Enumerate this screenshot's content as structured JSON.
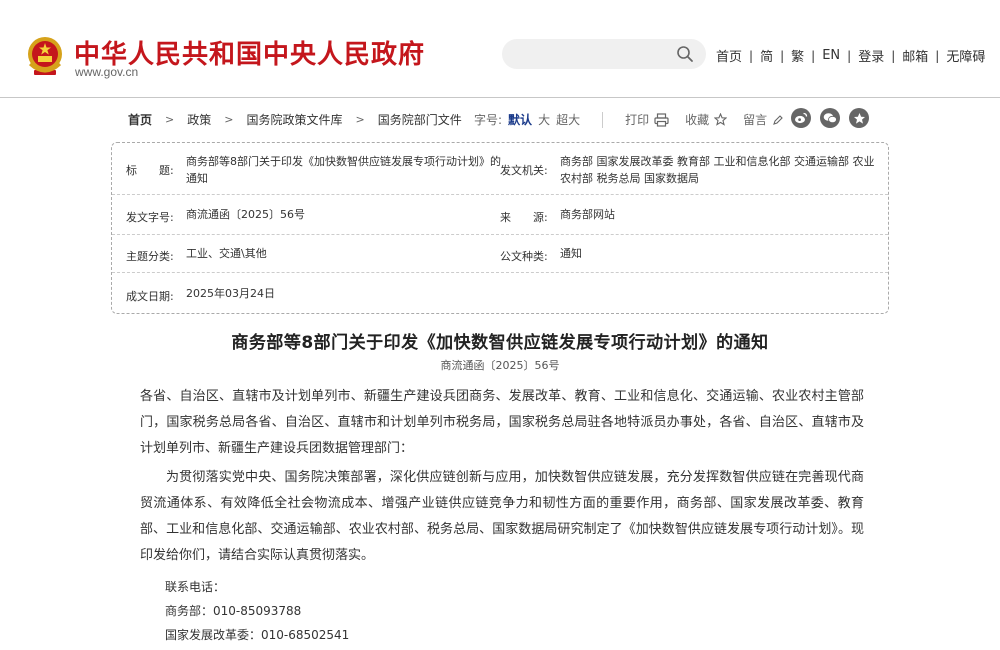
{
  "header": {
    "site_title": "中华人民共和国中央人民政府",
    "site_url": "www.gov.cn",
    "search_placeholder": "",
    "links": [
      "首页",
      "简",
      "繁",
      "EN",
      "登录",
      "邮箱",
      "无障碍"
    ]
  },
  "breadcrumb": [
    "首页",
    "政策",
    "国务院政策文件库",
    "国务院部门文件"
  ],
  "tools": {
    "font_label": "字号:",
    "font_sizes": [
      "默认",
      "大",
      "超大"
    ],
    "print_label": "打印",
    "favorite_label": "收藏",
    "comment_label": "留言"
  },
  "share_icons": [
    "weibo-icon",
    "wechat-icon",
    "qzone-icon"
  ],
  "info": {
    "title_label": "标　　题:",
    "title_value": "商务部等8部门关于印发《加快数智供应链发展专项行动计划》的通知",
    "issuer_label": "发文机关:",
    "issuer_value": "商务部 国家发展改革委 教育部 工业和信息化部 交通运输部 农业农村部 税务总局 国家数据局",
    "docno_label": "发文字号:",
    "docno_value": "商流通函〔2025〕56号",
    "source_label": "来　　源:",
    "source_value": "商务部网站",
    "topic_label": "主题分类:",
    "topic_value": "工业、交通\\其他",
    "type_label": "公文种类:",
    "type_value": "通知",
    "date_label": "成文日期:",
    "date_value": "2025年03月24日"
  },
  "article": {
    "title": "商务部等8部门关于印发《加快数智供应链发展专项行动计划》的通知",
    "docno": "商流通函〔2025〕56号",
    "addressee": "各省、自治区、直辖市及计划单列市、新疆生产建设兵团商务、发展改革、教育、工业和信息化、交通运输、农业农村主管部门，国家税务总局各省、自治区、直辖市和计划单列市税务局，国家税务总局驻各地特派员办事处，各省、自治区、直辖市及计划单列市、新疆生产建设兵团数据管理部门：",
    "body": "为贯彻落实党中央、国务院决策部署，深化供应链创新与应用，加快数智供应链发展，充分发挥数智供应链在完善现代商贸流通体系、有效降低全社会物流成本、增强产业链供应链竞争力和韧性方面的重要作用，商务部、国家发展改革委、教育部、工业和信息化部、交通运输部、农业农村部、税务总局、国家数据局研究制定了《加快数智供应链发展专项行动计划》。现印发给你们，请结合实际认真贯彻落实。",
    "contact_label": "联系电话：",
    "contacts": [
      "商务部：010-85093788",
      "国家发展改革委：010-68502541"
    ]
  },
  "colors": {
    "brand_red": "#c4161c",
    "active_blue": "#1a3a8a"
  }
}
